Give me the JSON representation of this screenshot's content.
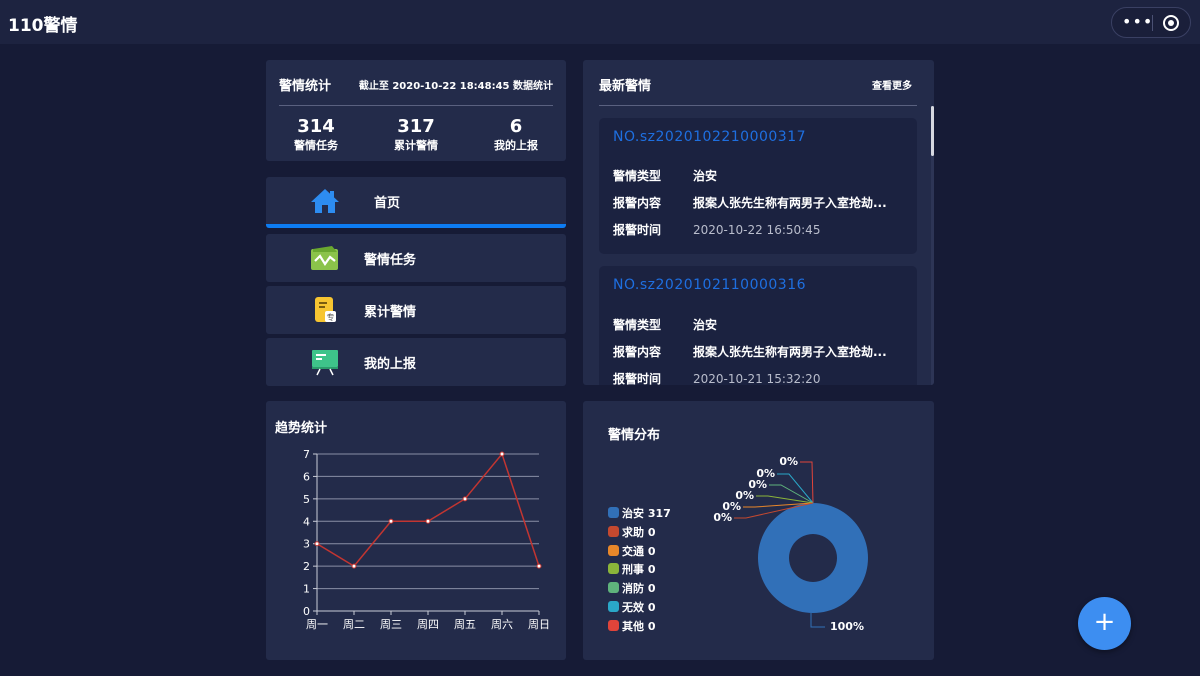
{
  "app": {
    "title": "110警情",
    "menu_icon": "more-dots-icon",
    "close_icon": "target-close-icon"
  },
  "stats": {
    "title": "警情统计",
    "date_text": "截止至 2020-10-22 18:48:45 数据统计",
    "items": [
      {
        "value": "314",
        "label": "警情任务"
      },
      {
        "value": "317",
        "label": "累计警情"
      },
      {
        "value": "6",
        "label": "我的上报"
      }
    ]
  },
  "nav": [
    {
      "label": "首页",
      "icon": "home-icon",
      "active": true
    },
    {
      "label": "警情任务",
      "icon": "task-icon",
      "active": false
    },
    {
      "label": "累计警情",
      "icon": "document-icon",
      "active": false
    },
    {
      "label": "我的上报",
      "icon": "board-icon",
      "active": false
    }
  ],
  "alerts": {
    "title": "最新警情",
    "more_label": "查看更多",
    "items": [
      {
        "no": "NO.sz2020102210000317",
        "type_label": "警情类型",
        "type": "治安",
        "content_label": "报警内容",
        "content": "报案人张先生称有两男子入室抢劫...",
        "time_label": "报警时间",
        "time": "2020-10-22 16:50:45"
      },
      {
        "no": "NO.sz2020102110000316",
        "type_label": "警情类型",
        "type": "治安",
        "content_label": "报警内容",
        "content": "报案人张先生称有两男子入室抢劫...",
        "time_label": "报警时间",
        "time": "2020-10-21 15:32:20"
      }
    ]
  },
  "trend": {
    "title": "趋势统计"
  },
  "distribution": {
    "title": "警情分布"
  },
  "fab": {
    "label": "+",
    "icon": "plus-icon"
  },
  "colors": {
    "background": "#161b36",
    "card": "#232b4a",
    "accent": "#0d7cf2",
    "line": "#c23531",
    "pie_main": "#3170b8"
  },
  "chart_data": [
    {
      "type": "line",
      "title": "趋势统计",
      "categories": [
        "周一",
        "周二",
        "周三",
        "周四",
        "周五",
        "周六",
        "周日"
      ],
      "series": [
        {
          "values": [
            3,
            2,
            4,
            4,
            5,
            7,
            2
          ]
        }
      ],
      "ylim": [
        0,
        7
      ],
      "yticks": [
        0,
        1,
        2,
        3,
        4,
        5,
        6,
        7
      ],
      "grid": true,
      "color": "#c23531"
    },
    {
      "type": "pie",
      "title": "警情分布",
      "legend_position": "left",
      "slices": [
        {
          "name": "治安",
          "value": 317,
          "percent": "100%",
          "color": "#3170b8"
        },
        {
          "name": "求助",
          "value": 0,
          "percent": "0%",
          "color": "#c4492f"
        },
        {
          "name": "交通",
          "value": 0,
          "percent": "0%",
          "color": "#e8872a"
        },
        {
          "name": "刑事",
          "value": 0,
          "percent": "0%",
          "color": "#8bb53a"
        },
        {
          "name": "消防",
          "value": 0,
          "percent": "0%",
          "color": "#5fb37c"
        },
        {
          "name": "无效",
          "value": 0,
          "percent": "0%",
          "color": "#2aa7c8"
        },
        {
          "name": "其他",
          "value": 0,
          "percent": "0%",
          "color": "#e0443a"
        }
      ]
    }
  ]
}
